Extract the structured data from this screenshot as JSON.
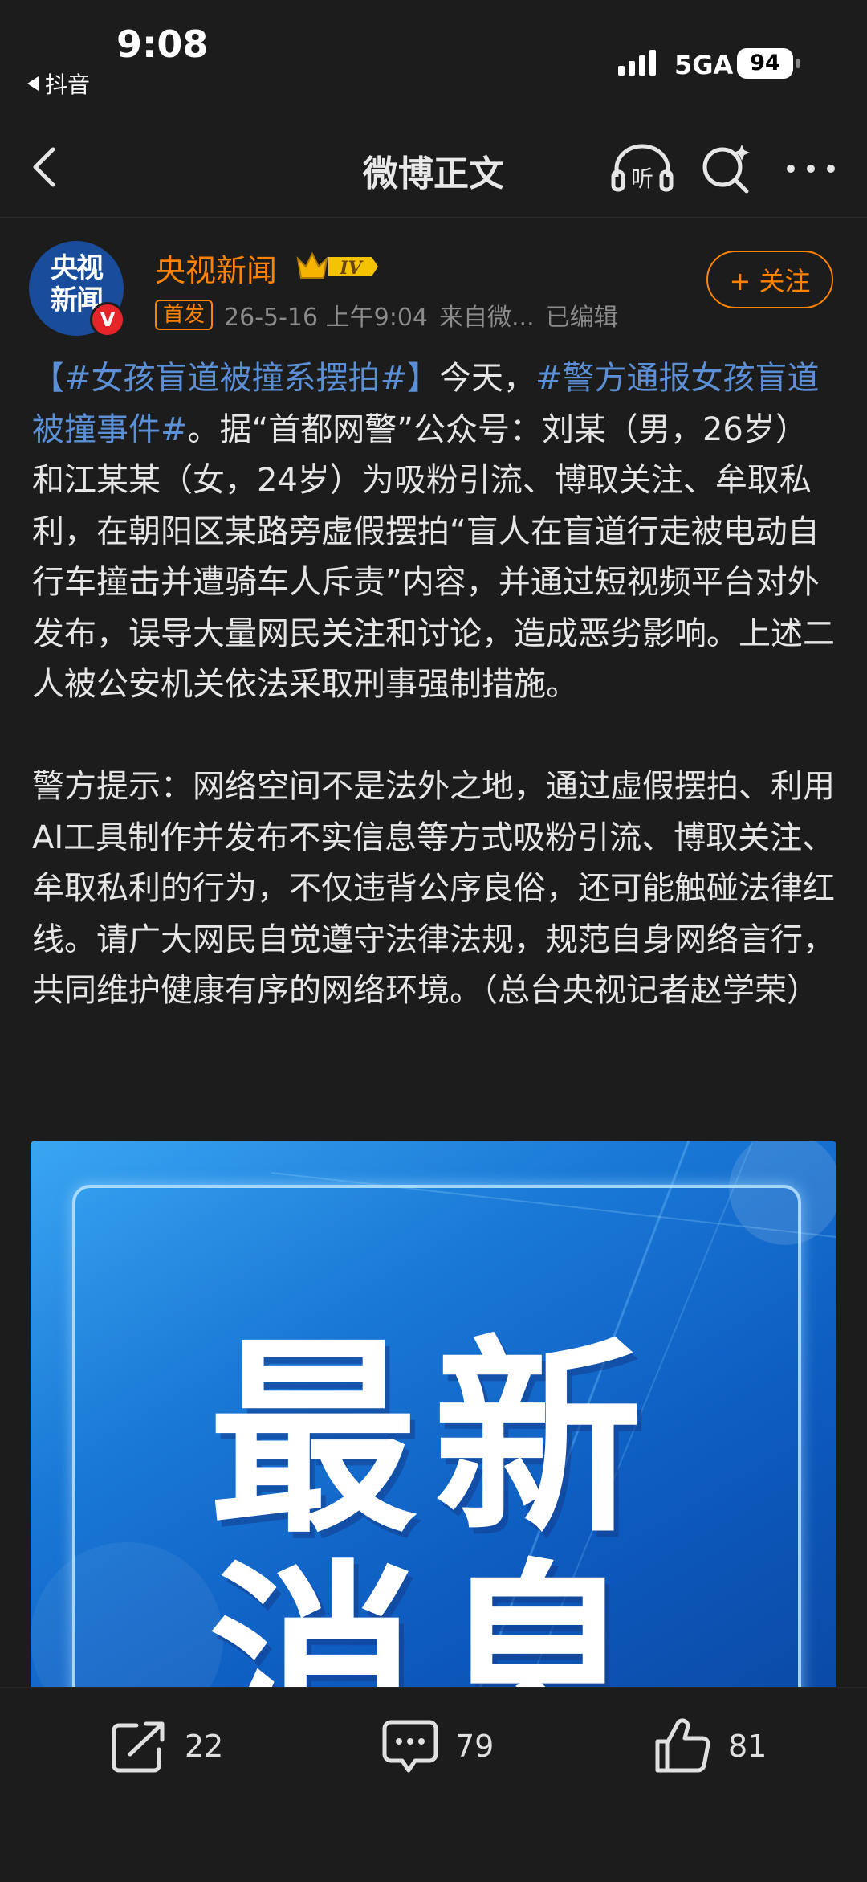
{
  "status_bar": {
    "time": "9:08",
    "back_app": "抖音",
    "network": "5GA",
    "battery": "94"
  },
  "nav": {
    "title": "微博正文"
  },
  "author": {
    "avatar_text_line1": "央视",
    "avatar_text_line2": "新闻",
    "avatar_badge": "V",
    "name": "央视新闻",
    "level": "IV",
    "first_tag": "首发",
    "time": "26-5-16 上午9:04",
    "source": "来自微...",
    "edited": "已编辑",
    "follow_label": "+ 关注"
  },
  "post": {
    "tag1": "【#女孩盲道被撞系摆拍#】",
    "lead": "今天，",
    "tag2": "#警方通报女孩盲道被撞事件#",
    "para1": "。据“首都网警”公众号：刘某（男，26岁）和江某某（女，24岁）为吸粉引流、博取关注、牟取私利，在朝阳区某路旁虚假摆拍“盲人在盲道行走被电动自行车撞击并遭骑车人斥责”内容，并通过短视频平台对外发布，误导大量网民关注和讨论，造成恶劣影响。上述二人被公安机关依法采取刑事强制措施。",
    "para2": "警方提示：网络空间不是法外之地，通过虚假摆拍、利用AI工具制作并发布不实信息等方式吸粉引流、博取关注、牟取私利的行为，不仅违背公序良俗，还可能触碰法律红线。请广大网民自觉遵守法律法规，规范自身网络言行，共同维护健康有序的网络环境。（总台央视记者赵学荣）"
  },
  "image": {
    "line1": "最新",
    "line2": "消息"
  },
  "actions": {
    "share_count": "22",
    "comment_count": "79",
    "like_count": "81"
  },
  "colors": {
    "background": "#1c1c1c",
    "accent": "#ff8200",
    "topic_link": "#5b8fd6"
  }
}
